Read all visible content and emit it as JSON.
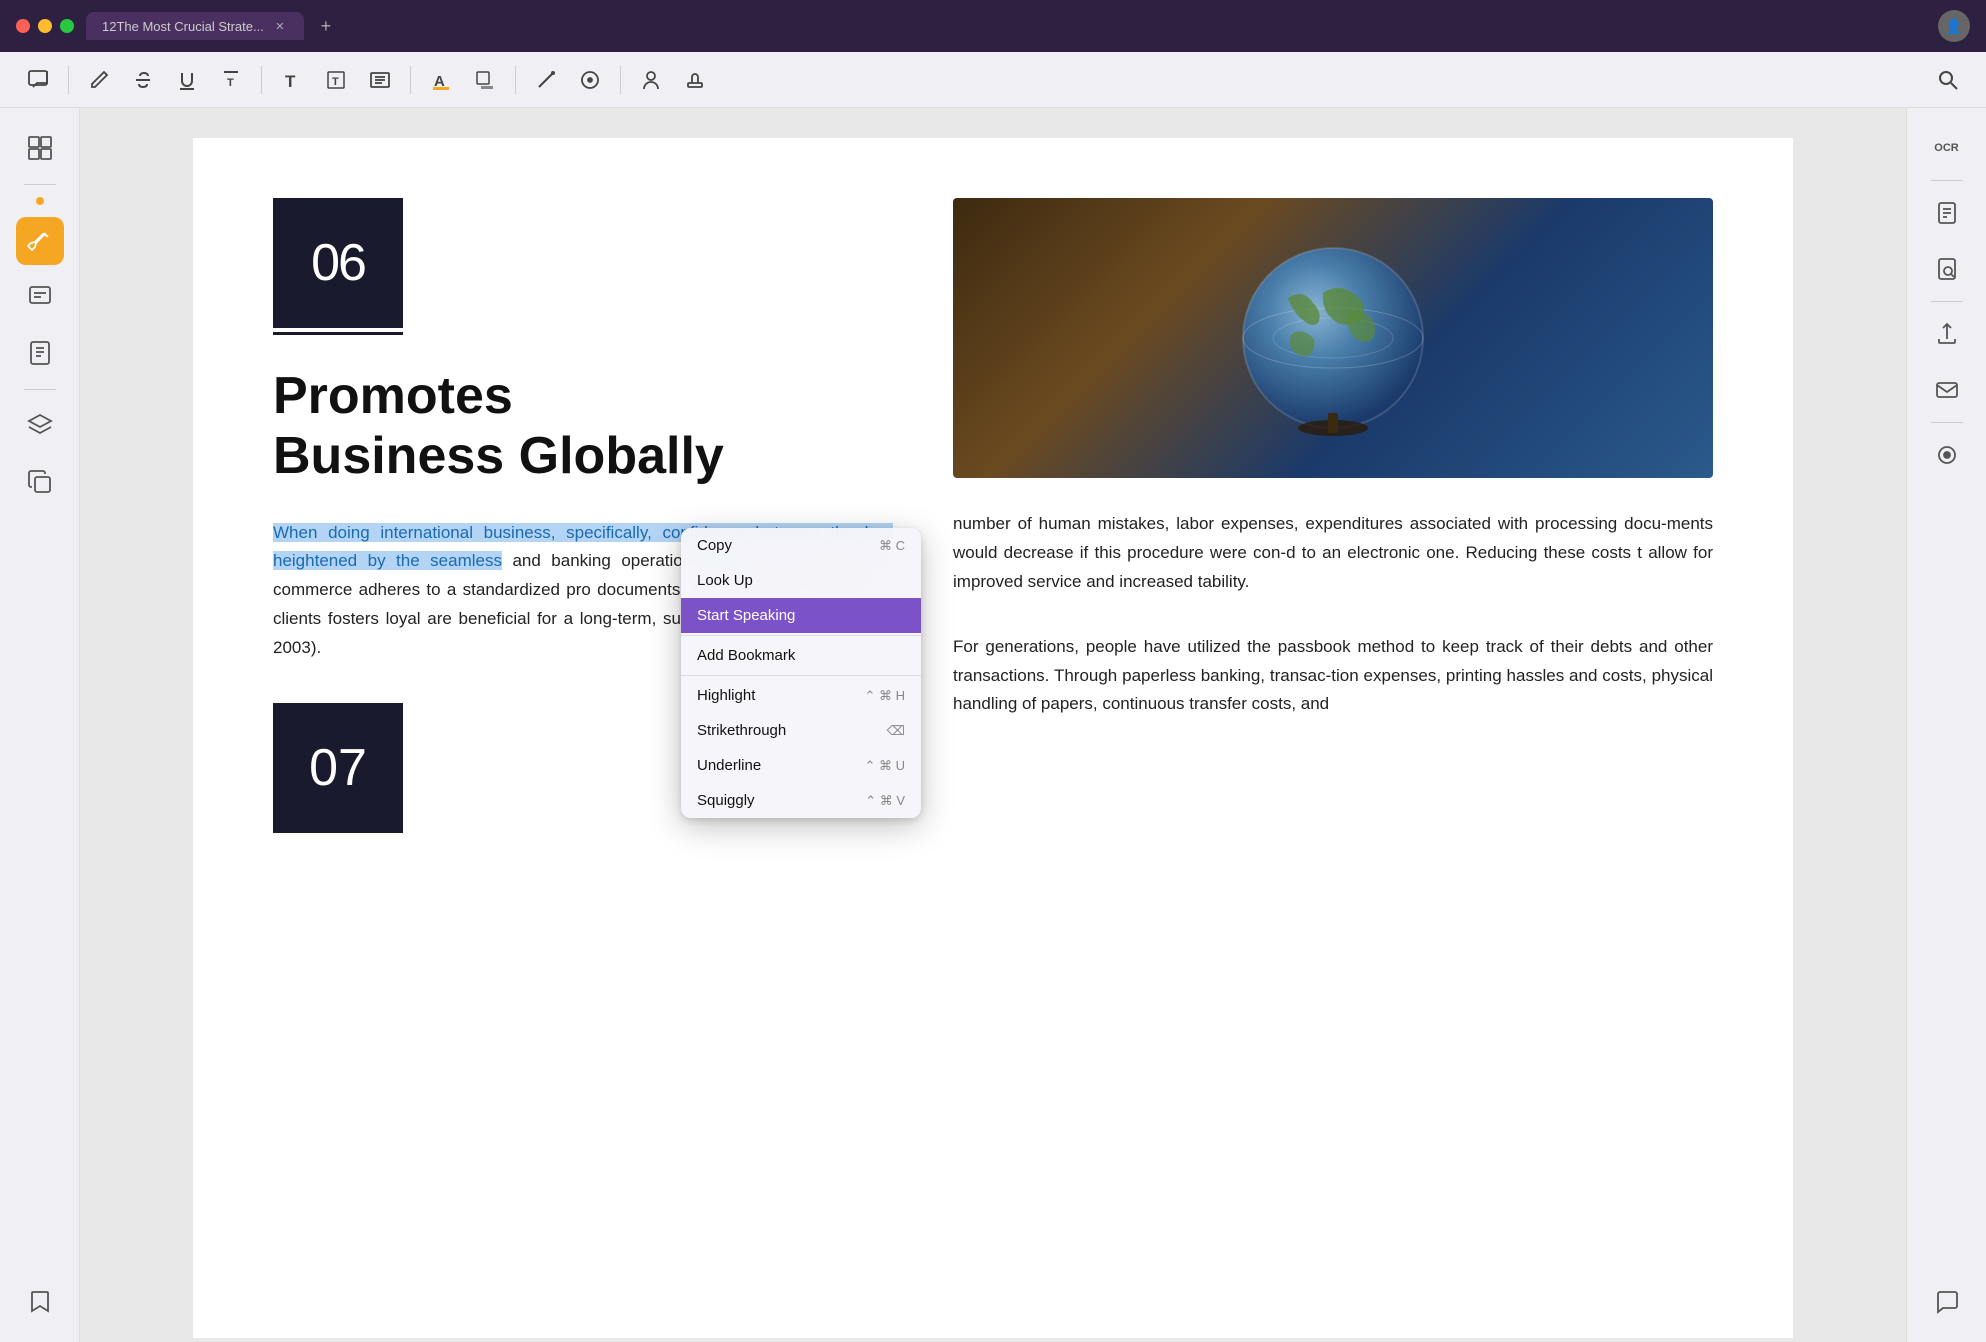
{
  "titlebar": {
    "tab_title": "12The Most Crucial Strate...",
    "add_tab_label": "+"
  },
  "toolbar": {
    "icons": [
      {
        "name": "comment-icon",
        "symbol": "💬"
      },
      {
        "name": "pen-icon",
        "symbol": "✒"
      },
      {
        "name": "strikethrough-icon",
        "symbol": "S̶"
      },
      {
        "name": "underline-icon",
        "symbol": "U"
      },
      {
        "name": "overline-icon",
        "symbol": "T"
      },
      {
        "name": "text-icon",
        "symbol": "T"
      },
      {
        "name": "text-box-icon",
        "symbol": "T"
      },
      {
        "name": "list-icon",
        "symbol": "☰"
      },
      {
        "name": "highlight-icon",
        "symbol": "A"
      },
      {
        "name": "color-fill-icon",
        "symbol": "🟨"
      },
      {
        "name": "line-icon",
        "symbol": "/"
      },
      {
        "name": "shape-icon",
        "symbol": "◯"
      },
      {
        "name": "person-icon",
        "symbol": "👤"
      },
      {
        "name": "stamp-icon",
        "symbol": "🔏"
      }
    ],
    "search_label": "Search"
  },
  "left_sidebar": {
    "items": [
      {
        "name": "thumbnails-icon",
        "symbol": "⊞",
        "active": false
      },
      {
        "name": "highlight-tool-icon",
        "symbol": "🖊",
        "active": true
      },
      {
        "name": "annotations-icon",
        "symbol": "📝",
        "active": false
      },
      {
        "name": "bookmarks-icon",
        "symbol": "🔖",
        "active": false
      },
      {
        "name": "layers-icon",
        "symbol": "⊕",
        "active": false
      },
      {
        "name": "copy-icon",
        "symbol": "⧉",
        "active": false
      },
      {
        "name": "bookmark-icon",
        "symbol": "🔖",
        "active": false
      }
    ]
  },
  "pdf": {
    "chapter_number": "06",
    "title_line1": "Promotes",
    "title_line2": "Business Globally",
    "body_text_highlighted": "When doing international business, specifically, confidence between the ban",
    "body_text_highlighted2": "heightened by the seamless",
    "body_paragraph1": "When doing international business, specifically, confidence between the ban heightened by the seamless and banking operations. It c party engaged in commerce adheres to a standardized pro documents. This openness b and their clients fosters loyal are beneficial for a long-term, sustainable future (Hee et al., 2003).",
    "right_col_text1": "number of human mistakes, labor expenses, expenditures associated with processing docu- ments would decrease if this procedure were con- d to an electronic one. Reducing these costs t allow for improved service and increased tability.",
    "right_col_text2": "For generations, people have utilized the passbook method to keep track of their debts and other transactions. Through paperless banking, transac- tion expenses, printing hassles and costs, physical handling of papers, continuous transfer costs, and",
    "chapter_number_bottom": "07"
  },
  "context_menu": {
    "items": [
      {
        "label": "Copy",
        "shortcut": "⌘ C",
        "active": false
      },
      {
        "label": "Look Up",
        "shortcut": "",
        "active": false
      },
      {
        "label": "Start Speaking",
        "shortcut": "",
        "active": true
      },
      {
        "label": "Add Bookmark",
        "shortcut": "",
        "active": false
      },
      {
        "label": "Highlight",
        "shortcut": "⌃ ⌘ H",
        "active": false
      },
      {
        "label": "Strikethrough",
        "shortcut": "⌫",
        "active": false
      },
      {
        "label": "Underline",
        "shortcut": "⌃ ⌘ U",
        "active": false
      },
      {
        "label": "Squiggly",
        "shortcut": "⌃ ⌘ V",
        "active": false
      }
    ]
  },
  "right_sidebar": {
    "items": [
      {
        "name": "ocr-icon",
        "symbol": "OCR"
      },
      {
        "name": "document-icon",
        "symbol": "📄"
      },
      {
        "name": "search-doc-icon",
        "symbol": "🔍"
      },
      {
        "name": "share-icon",
        "symbol": "⬆"
      },
      {
        "name": "email-icon",
        "symbol": "✉"
      },
      {
        "name": "record-icon",
        "symbol": "⏺"
      },
      {
        "name": "comment-right-icon",
        "symbol": "💬"
      }
    ]
  }
}
